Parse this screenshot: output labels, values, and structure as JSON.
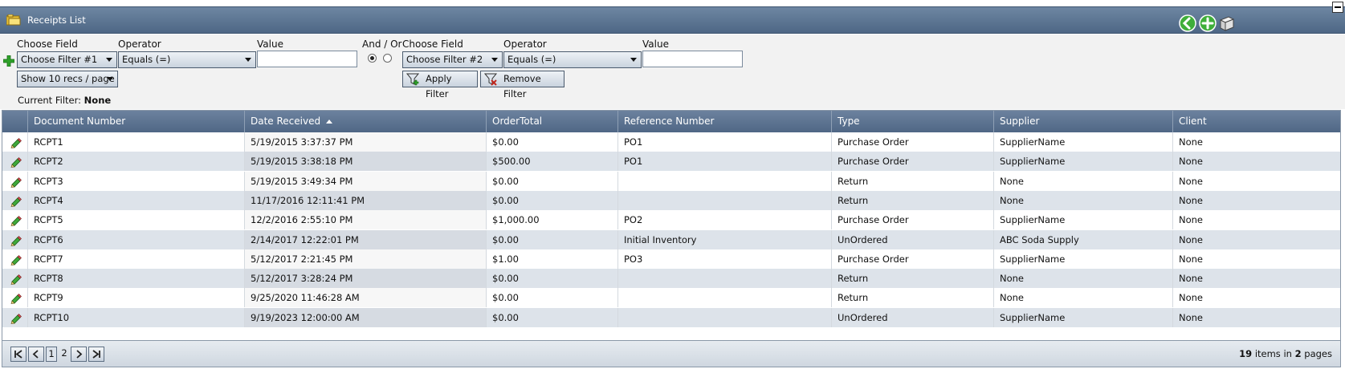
{
  "window": {
    "title": "Receipts List"
  },
  "filters": {
    "choose_field_label": "Choose Field",
    "operator_label": "Operator",
    "value_label": "Value",
    "and_or_label": "And / Or",
    "filter1": {
      "field": "Choose Filter #1",
      "operator": "Equals (=)",
      "value": ""
    },
    "filter2": {
      "field": "Choose Filter #2",
      "operator": "Equals (=)",
      "value": ""
    },
    "page_size": "Show 10 recs / page",
    "apply_label": "Apply Filter",
    "remove_label": "Remove Filter",
    "current_filter_label": "Current Filter:",
    "current_filter_value": "None"
  },
  "grid": {
    "columns": [
      "Document Number",
      "Date Received",
      "OrderTotal",
      "Reference Number",
      "Type",
      "Supplier",
      "Client"
    ],
    "rows": [
      [
        "RCPT1",
        "5/19/2015 3:37:37 PM",
        "$0.00",
        "PO1",
        "Purchase Order",
        "SupplierName",
        "None"
      ],
      [
        "RCPT2",
        "5/19/2015 3:38:18 PM",
        "$500.00",
        "PO1",
        "Purchase Order",
        "SupplierName",
        "None"
      ],
      [
        "RCPT3",
        "5/19/2015 3:49:34 PM",
        "$0.00",
        "",
        "Return",
        "None",
        "None"
      ],
      [
        "RCPT4",
        "11/17/2016 12:11:41 PM",
        "$0.00",
        "",
        "Return",
        "None",
        "None"
      ],
      [
        "RCPT5",
        "12/2/2016 2:55:10 PM",
        "$1,000.00",
        "PO2",
        "Purchase Order",
        "SupplierName",
        "None"
      ],
      [
        "RCPT6",
        "2/14/2017 12:22:01 PM",
        "$0.00",
        "Initial Inventory",
        "UnOrdered",
        "ABC Soda Supply",
        "None"
      ],
      [
        "RCPT7",
        "5/12/2017 2:21:45 PM",
        "$1.00",
        "PO3",
        "Purchase Order",
        "SupplierName",
        "None"
      ],
      [
        "RCPT8",
        "5/12/2017 3:28:24 PM",
        "$0.00",
        "",
        "Return",
        "None",
        "None"
      ],
      [
        "RCPT9",
        "9/25/2020 11:46:28 AM",
        "$0.00",
        "",
        "Return",
        "None",
        "None"
      ],
      [
        "RCPT10",
        "9/19/2023 12:00:00 AM",
        "$0.00",
        "",
        "UnOrdered",
        "SupplierName",
        "None"
      ]
    ]
  },
  "pager": {
    "pages": [
      "1",
      "2"
    ],
    "current": "1",
    "items_count": "19",
    "items_text": "items in",
    "pages_count": "2",
    "pages_text": "pages"
  }
}
